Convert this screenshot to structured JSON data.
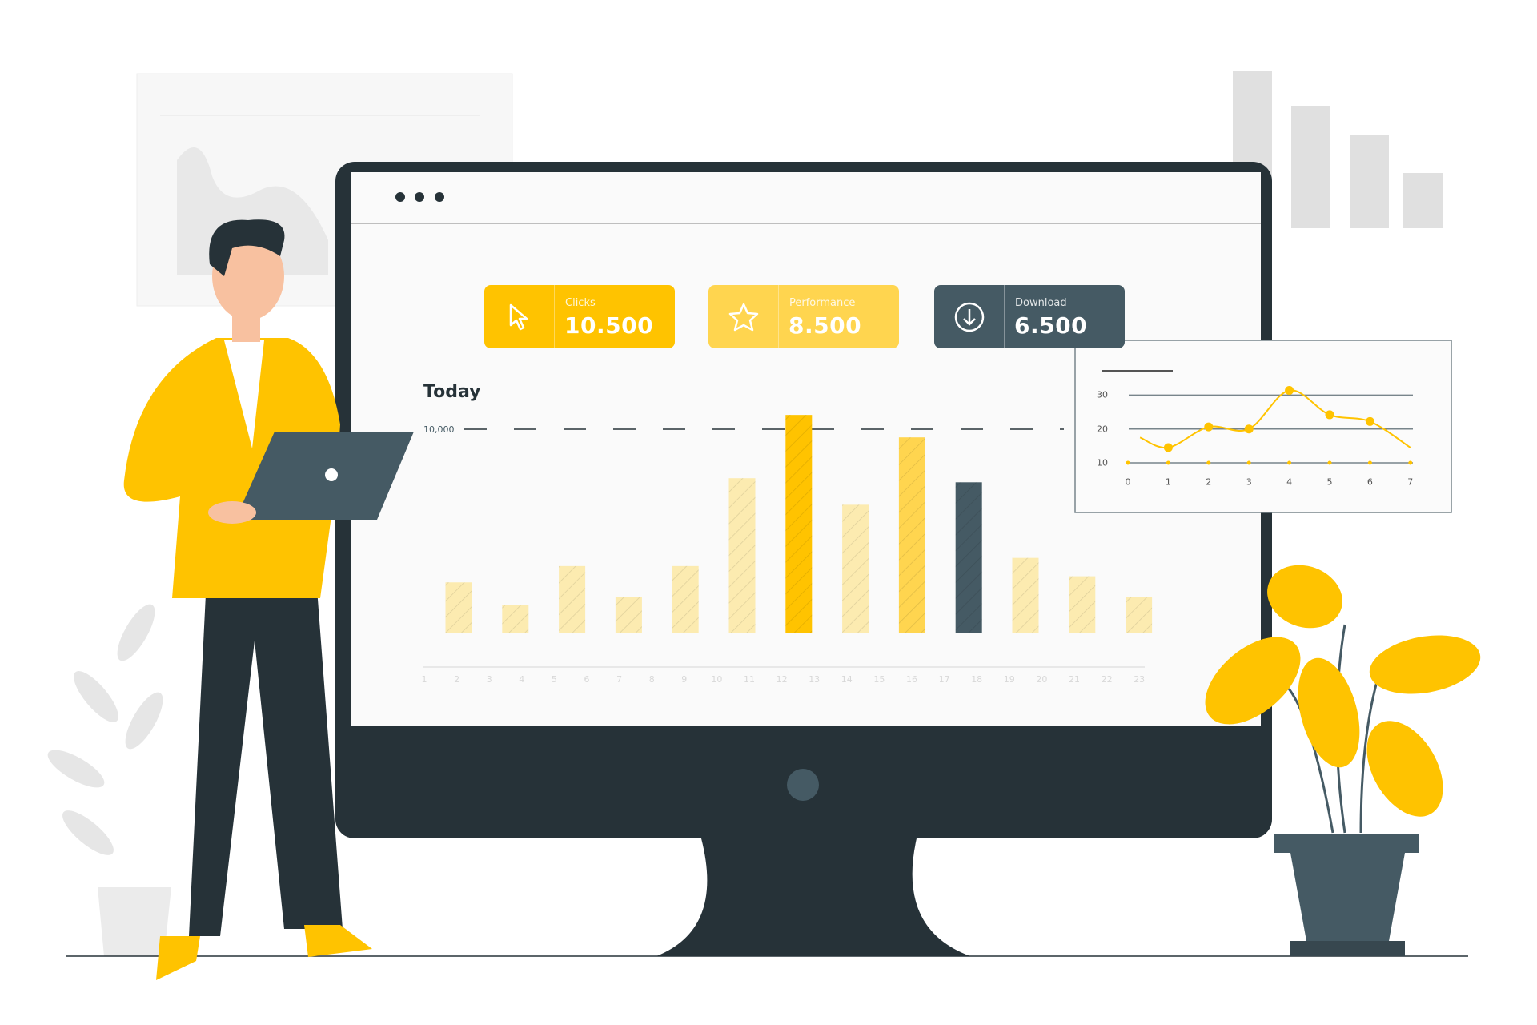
{
  "window": {
    "dots": 3
  },
  "cards": [
    {
      "label": "Clicks",
      "value": "10.500",
      "icon": "cursor-icon",
      "color": "#FFC300"
    },
    {
      "label": "Performance",
      "value": "8.500",
      "icon": "star-icon",
      "color": "#FFD54F"
    },
    {
      "label": "Download",
      "value": "6.500",
      "icon": "download-icon",
      "color": "#455A64"
    }
  ],
  "colors": {
    "accent": "#FFC300",
    "accent_light": "#FFD54F",
    "bar_light": "#FCEBB0",
    "slate": "#455A64",
    "monitor": "#263238"
  },
  "chart_data": [
    {
      "type": "bar",
      "title": "Today",
      "reference_line": {
        "label": "10,000",
        "value": 10000
      },
      "x_tick_labels": [
        "1",
        "2",
        "3",
        "4",
        "5",
        "6",
        "7",
        "8",
        "9",
        "10",
        "11",
        "12",
        "13",
        "14",
        "15",
        "16",
        "17",
        "18",
        "19",
        "20",
        "21",
        "22",
        "23"
      ],
      "values": [
        2500,
        1400,
        3300,
        1800,
        3300,
        7600,
        10700,
        6300,
        9600,
        7400,
        3700,
        2800,
        1800
      ],
      "bar_colors": [
        "#FCEBB0",
        "#FCEBB0",
        "#FCEBB0",
        "#FCEBB0",
        "#FCEBB0",
        "#FCEBB0",
        "#FFC300",
        "#FCEBB0",
        "#FFD54F",
        "#455A64",
        "#FCEBB0",
        "#FCEBB0",
        "#FCEBB0"
      ],
      "ylim": [
        0,
        10000
      ],
      "grid": false
    },
    {
      "type": "line",
      "x": [
        1,
        2,
        3,
        4,
        5,
        6
      ],
      "y": [
        14.5,
        20.6,
        20,
        31.4,
        24.2,
        22.2
      ],
      "x_tick_labels": [
        "0",
        "1",
        "2",
        "3",
        "4",
        "5",
        "6",
        "7"
      ],
      "y_tick_labels": [
        "30",
        "20",
        "10"
      ],
      "xlim": [
        0,
        7
      ],
      "ylim": [
        10,
        30
      ],
      "grid": true,
      "color": "#FFC300"
    }
  ]
}
